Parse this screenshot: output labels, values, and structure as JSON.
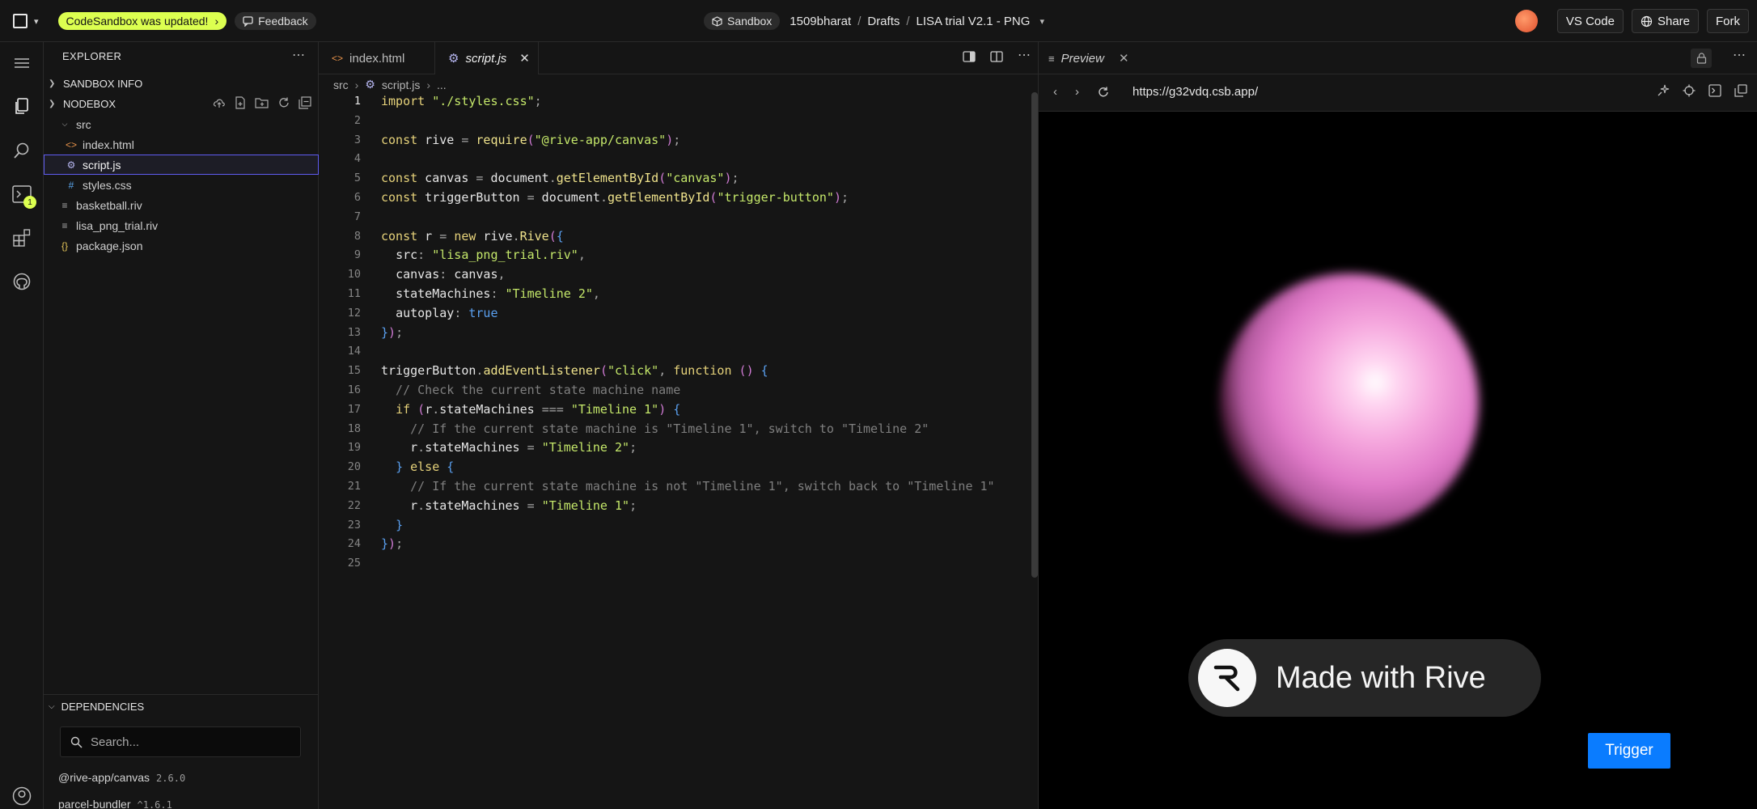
{
  "topbar": {
    "update_pill": "CodeSandbox was updated!",
    "feedback_label": "Feedback",
    "sandbox_label": "Sandbox",
    "crumbs": [
      "1509bharat",
      "Drafts",
      "LISA trial V2.1 - PNG"
    ],
    "vscode_label": "VS Code",
    "share_label": "Share",
    "fork_label": "Fork"
  },
  "activity": {
    "badge_count": "1"
  },
  "explorer": {
    "title": "EXPLORER",
    "sandbox_info": "SANDBOX INFO",
    "nodebox": "NODEBOX",
    "files": [
      {
        "name": "src",
        "kind": "folder"
      },
      {
        "name": "index.html",
        "kind": "html"
      },
      {
        "name": "script.js",
        "kind": "js"
      },
      {
        "name": "styles.css",
        "kind": "css"
      },
      {
        "name": "basketball.riv",
        "kind": "file"
      },
      {
        "name": "lisa_png_trial.riv",
        "kind": "file"
      },
      {
        "name": "package.json",
        "kind": "json"
      }
    ],
    "dependencies_title": "DEPENDENCIES",
    "search_placeholder": "Search...",
    "deps": [
      {
        "name": "@rive-app/canvas",
        "version": "2.6.0"
      },
      {
        "name": "parcel-bundler",
        "version": "^1.6.1"
      }
    ]
  },
  "editor": {
    "tabs": [
      {
        "label": "index.html"
      },
      {
        "label": "script.js"
      }
    ],
    "crumbs": [
      "src",
      "script.js",
      "..."
    ],
    "lines": [
      "import \"./styles.css\";",
      "",
      "const rive = require(\"@rive-app/canvas\");",
      "",
      "const canvas = document.getElementById(\"canvas\");",
      "const triggerButton = document.getElementById(\"trigger-button\");",
      "",
      "const r = new rive.Rive({",
      "  src: \"lisa_png_trial.riv\",",
      "  canvas: canvas,",
      "  stateMachines: \"Timeline 2\",",
      "  autoplay: true",
      "});",
      "",
      "triggerButton.addEventListener(\"click\", function () {",
      "  // Check the current state machine name",
      "  if (r.stateMachines === \"Timeline 1\") {",
      "    // If the current state machine is \"Timeline 1\", switch to \"Timeline 2\"",
      "    r.stateMachines = \"Timeline 2\";",
      "  } else {",
      "    // If the current state machine is not \"Timeline 1\", switch back to \"Timeline 1\"",
      "    r.stateMachines = \"Timeline 1\";",
      "  }",
      "});",
      ""
    ]
  },
  "preview": {
    "tab_label": "Preview",
    "url": "https://g32vdq.csb.app/",
    "made_with": "Made with Rive",
    "trigger_label": "Trigger"
  },
  "colors": {
    "accent": "#dcff50",
    "selection_border": "#5f5cf0",
    "trigger_blue": "#0a7cff"
  }
}
